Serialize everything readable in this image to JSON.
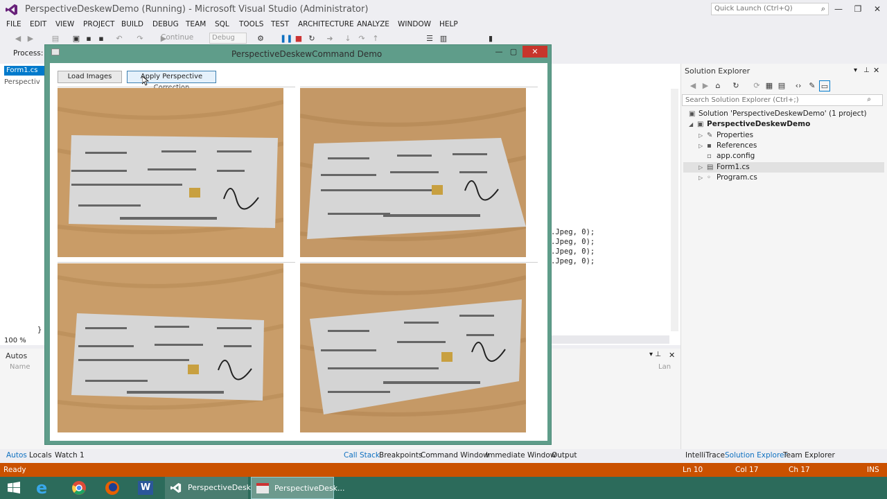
{
  "app": {
    "title": "PerspectiveDeskewDemo (Running) - Microsoft Visual Studio (Administrator)",
    "quick_launch": "Quick Launch (Ctrl+Q)"
  },
  "menu": [
    "FILE",
    "EDIT",
    "VIEW",
    "PROJECT",
    "BUILD",
    "DEBUG",
    "TEAM",
    "SQL",
    "TOOLS",
    "TEST",
    "ARCHITECTURE",
    "ANALYZE",
    "WINDOW",
    "HELP"
  ],
  "toolbar": {
    "continue_label": "Continue",
    "config": "Debug"
  },
  "process_label": "Process:",
  "editor": {
    "tab": "Form1.cs",
    "nav": "Perspectiv",
    "code_lines": [
      ".Jpeg, 0);",
      ".Jpeg, 0);",
      ".Jpeg, 0);",
      ".Jpeg, 0);"
    ],
    "closing_brace": "}",
    "zoom": "100 %"
  },
  "demo_window": {
    "title": "PerspectiveDeskewCommand Demo",
    "load_button": "Load Images",
    "apply_button": "Apply Perspective Correction"
  },
  "autos": {
    "title": "Autos",
    "col_name": "Name",
    "col_lang": "Lan"
  },
  "solution_explorer": {
    "title": "Solution Explorer",
    "search_placeholder": "Search Solution Explorer (Ctrl+;)",
    "solution": "Solution 'PerspectiveDeskewDemo' (1 project)",
    "project": "PerspectiveDeskewDemo",
    "items": [
      "Properties",
      "References",
      "app.config",
      "Form1.cs",
      "Program.cs"
    ]
  },
  "bottom_tabs_left": [
    "Autos",
    "Locals",
    "Watch 1"
  ],
  "bottom_tabs_mid": [
    "Call Stack",
    "Breakpoints",
    "Command Window",
    "Immediate Window",
    "Output"
  ],
  "bottom_tabs_right": [
    "IntelliTrace",
    "Solution Explorer",
    "Team Explorer"
  ],
  "status": {
    "left": "Ready",
    "ln": "Ln 10",
    "col": "Col 17",
    "ch": "Ch 17",
    "mode": "INS"
  },
  "taskbar": {
    "vs": "PerspectiveDesk...",
    "app": "PerspectiveDesk..."
  },
  "colors": {
    "accent": "#007acc",
    "status_bar": "#ca5100",
    "taskbar": "#2c6b5b",
    "demo_frame": "#5f9d8a"
  }
}
